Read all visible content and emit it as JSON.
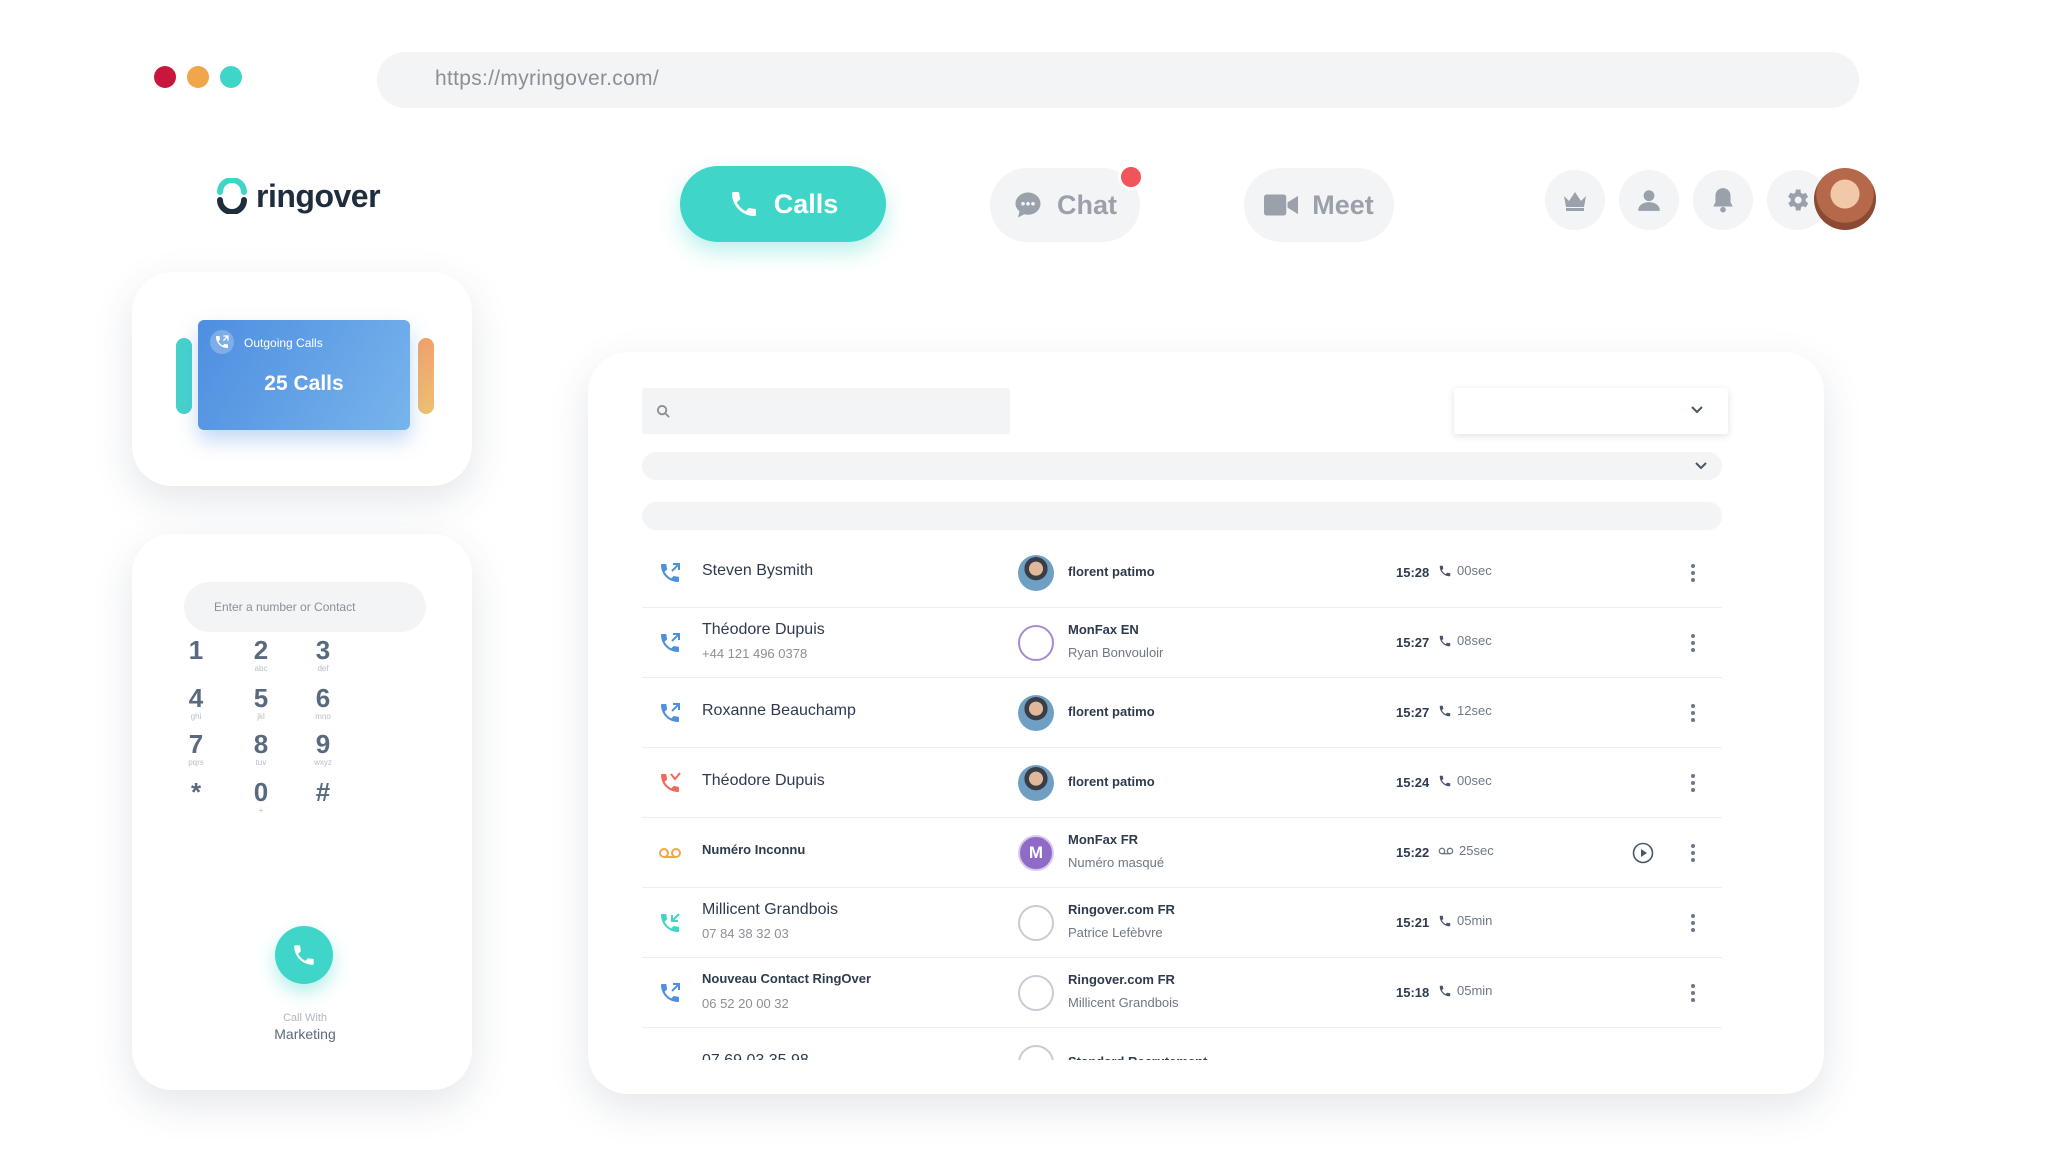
{
  "browser": {
    "url": "https://myringover.com/",
    "dots": [
      "#c8173a",
      "#f2a64a",
      "#3fd6c9"
    ]
  },
  "brand": {
    "name": "ringover",
    "accent": "#3fd6c9"
  },
  "nav": {
    "calls": "Calls",
    "chat": "Chat",
    "meet": "Meet"
  },
  "stats": {
    "label": "Outgoing Calls",
    "value": "25 Calls"
  },
  "dialer": {
    "placeholder": "Enter a number or Contact",
    "keys": [
      {
        "d": "1",
        "l": ""
      },
      {
        "d": "2",
        "l": "abc"
      },
      {
        "d": "3",
        "l": "def"
      },
      {
        "d": "4",
        "l": "ghi"
      },
      {
        "d": "5",
        "l": "jkl"
      },
      {
        "d": "6",
        "l": "mno"
      },
      {
        "d": "7",
        "l": "pqrs"
      },
      {
        "d": "8",
        "l": "tuv"
      },
      {
        "d": "9",
        "l": "wxyz"
      },
      {
        "d": "*",
        "l": ""
      },
      {
        "d": "0",
        "l": "+"
      },
      {
        "d": "#",
        "l": ""
      }
    ],
    "call_with_label": "Call With",
    "call_with_team": "Marketing"
  },
  "calls": [
    {
      "name": "Steven Bysmith",
      "sub": "",
      "line": "florent patimo",
      "owner": "",
      "time": "15:28",
      "dur": "00sec",
      "dir": "outgoing",
      "avatar": "photo",
      "play": false
    },
    {
      "name": "Théodore Dupuis",
      "sub": "+44 121 496 0378",
      "line": "MonFax EN",
      "owner": "Ryan Bonvouloir",
      "time": "15:27",
      "dur": "08sec",
      "dir": "outgoing",
      "avatar": "mon",
      "play": false
    },
    {
      "name": "Roxanne Beauchamp",
      "sub": "",
      "line": "florent patimo",
      "owner": "",
      "time": "15:27",
      "dur": "12sec",
      "dir": "outgoing",
      "avatar": "photo",
      "play": false
    },
    {
      "name": "Théodore Dupuis",
      "sub": "",
      "line": "florent patimo",
      "owner": "",
      "time": "15:24",
      "dur": "00sec",
      "dir": "missed",
      "avatar": "photo",
      "play": false
    },
    {
      "name": "Numéro Inconnu",
      "sub": "",
      "line": "MonFax FR",
      "owner": "Numéro masqué",
      "time": "15:22",
      "dur": "25sec",
      "dir": "voicemail",
      "avatar": "m",
      "play": true
    },
    {
      "name": "Millicent Grandbois",
      "sub": "07 84 38 32 03",
      "line": "Ringover.com FR",
      "owner": "Patrice Lefèbvre",
      "time": "15:21",
      "dur": "05min",
      "dir": "incoming",
      "avatar": "ringo",
      "play": false
    },
    {
      "name": "Nouveau Contact RingOver",
      "sub": "06 52 20 00 32",
      "line": "Ringover.com FR",
      "owner": "Millicent Grandbois",
      "time": "15:18",
      "dur": "05min",
      "dir": "outgoing",
      "avatar": "ringo",
      "play": false
    },
    {
      "name": "07 69 03 35 98",
      "sub": "",
      "line": "Standard Recrutement",
      "owner": "",
      "time": "",
      "dur": "",
      "dir": "",
      "avatar": "ringo",
      "play": false
    }
  ]
}
